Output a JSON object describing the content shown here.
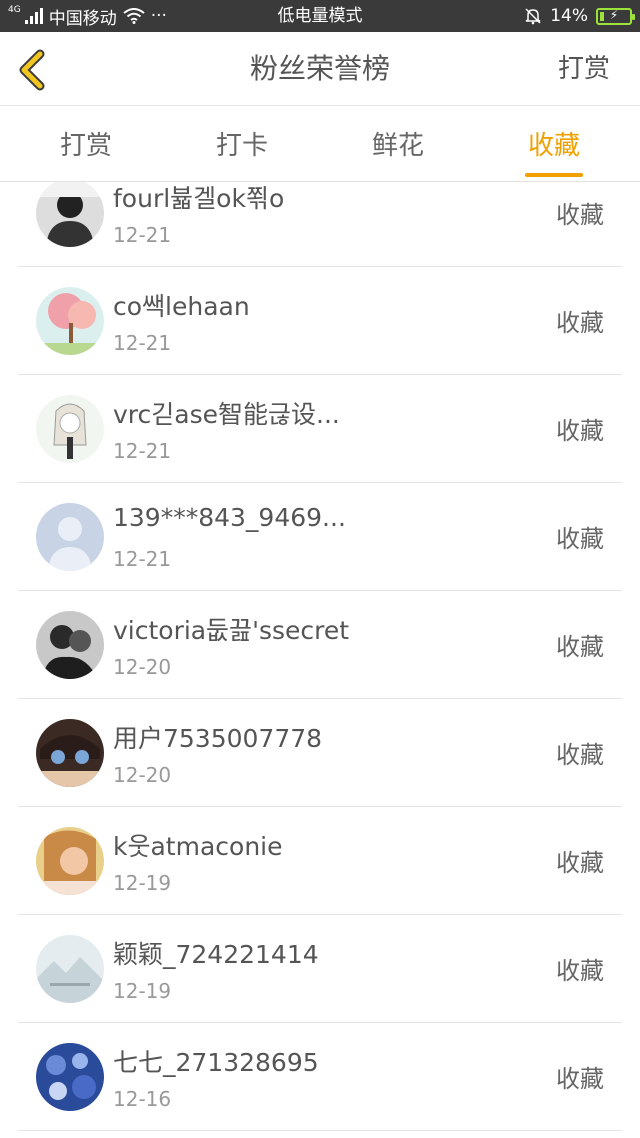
{
  "status_bar": {
    "network_small": "4G",
    "carrier": "中国移动",
    "more": "···",
    "mode": "低电量模式",
    "battery_percent": "14%",
    "battery_level": 0.14
  },
  "nav": {
    "title": "粉丝荣誉榜",
    "right_label": "打赏"
  },
  "tabs": [
    {
      "label": "打赏",
      "active": false
    },
    {
      "label": "打卡",
      "active": false
    },
    {
      "label": "鲜花",
      "active": false
    },
    {
      "label": "收藏",
      "active": true
    }
  ],
  "list": [
    {
      "name": "fourl뷻겔ok쬒o",
      "date": "12-21",
      "action": "收藏",
      "avatar": "dark-portrait"
    },
    {
      "name": "co쌕lehaan",
      "date": "12-21",
      "action": "收藏",
      "avatar": "pink-tree"
    },
    {
      "name": "vrc긷ase智能귾设...",
      "date": "12-21",
      "action": "收藏",
      "avatar": "anime-girl"
    },
    {
      "name": "139***843_9469...",
      "date": "12-21",
      "action": "收藏",
      "avatar": "default-user"
    },
    {
      "name": "victoria둢끒'ssecret",
      "date": "12-20",
      "action": "收藏",
      "avatar": "bw-couple"
    },
    {
      "name": "用户7535007778",
      "date": "12-20",
      "action": "收藏",
      "avatar": "anime-boy"
    },
    {
      "name": "k웃atmaconie",
      "date": "12-19",
      "action": "收藏",
      "avatar": "girl-photo"
    },
    {
      "name": "颖颖_724221414",
      "date": "12-19",
      "action": "收藏",
      "avatar": "landscape"
    },
    {
      "name": "七七_271328695",
      "date": "12-16",
      "action": "收藏",
      "avatar": "blue-flowers"
    }
  ],
  "colors": {
    "accent": "#f0a000",
    "status_bar_bg": "#3a3a3a",
    "battery": "#9be33b"
  }
}
